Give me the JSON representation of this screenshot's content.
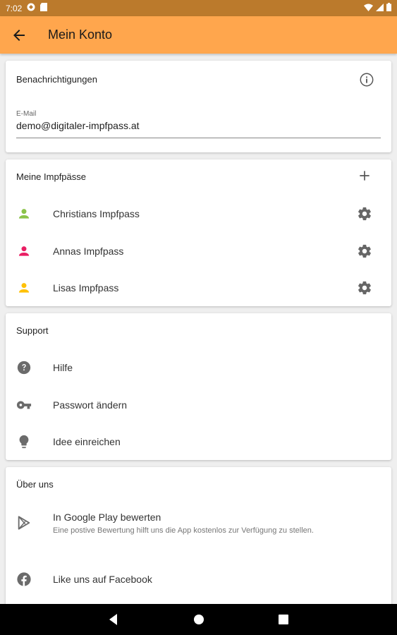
{
  "status_bar": {
    "time": "7:02"
  },
  "app_bar": {
    "title": "Mein Konto"
  },
  "notifications": {
    "header": "Benachrichtigungen",
    "email_label": "E-Mail",
    "email_value": "demo@digitaler-impfpass.at"
  },
  "passes": {
    "header": "Meine Impfpässe",
    "items": [
      {
        "label": "Christians Impfpass",
        "color": "#8bc34a"
      },
      {
        "label": "Annas Impfpass",
        "color": "#e91e63"
      },
      {
        "label": "Lisas Impfpass",
        "color": "#ffc107"
      }
    ]
  },
  "support": {
    "header": "Support",
    "items": [
      {
        "label": "Hilfe",
        "icon": "help-icon"
      },
      {
        "label": "Passwort ändern",
        "icon": "key-icon"
      },
      {
        "label": "Idee einreichen",
        "icon": "lightbulb-icon"
      }
    ]
  },
  "about": {
    "header": "Über uns",
    "rate_title": "In Google Play bewerten",
    "rate_subtitle": "Eine postive Bewertung hilft uns die App kostenlos zur Verfügung zu stellen.",
    "facebook": "Like uns auf Facebook"
  },
  "colors": {
    "accent": "#ffa64d",
    "status_bar": "#bb7a2c"
  }
}
